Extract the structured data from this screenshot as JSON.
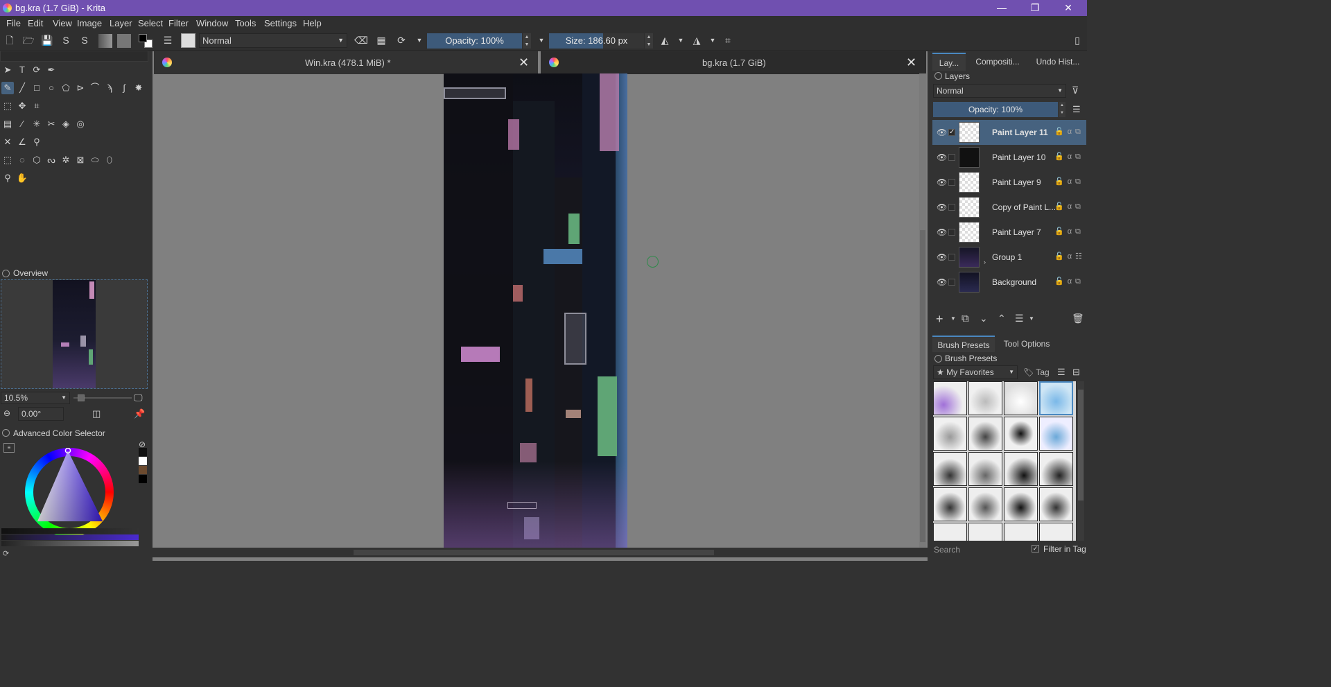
{
  "window": {
    "title": "bg.kra (1.7 GiB)  - Krita",
    "controls": {
      "minimize": "—",
      "restore": "❐",
      "close": "✕"
    }
  },
  "menu": [
    "File",
    "Edit",
    "View",
    "Image",
    "Layer",
    "Select",
    "Filter",
    "Window",
    "Tools",
    "Settings",
    "Help"
  ],
  "toolbar": {
    "blend_mode": "Normal",
    "opacity": "Opacity: 100%",
    "size": "Size: 186.60 px"
  },
  "overview": {
    "title": "Overview",
    "zoom": "10.5%",
    "rotation": "0.00°"
  },
  "color_selector": {
    "title": "Advanced Color Selector"
  },
  "documents": [
    {
      "label": "Win.kra (478.1 MiB) *"
    },
    {
      "label": "bg.kra (1.7 GiB)"
    }
  ],
  "right_tabs": [
    "Lay...",
    "Compositi...",
    "Undo Hist..."
  ],
  "layers": {
    "title": "Layers",
    "blend_mode": "Normal",
    "opacity": "Opacity:  100%",
    "items": [
      {
        "name": "Paint Layer 11",
        "selected": true
      },
      {
        "name": "Paint Layer 10",
        "selected": false
      },
      {
        "name": "Paint Layer 9",
        "selected": false
      },
      {
        "name": "Copy of Paint L...",
        "selected": false
      },
      {
        "name": "Paint Layer 7",
        "selected": false
      },
      {
        "name": "Group 1",
        "selected": false
      },
      {
        "name": "Background",
        "selected": false
      }
    ]
  },
  "bottom_tabs": [
    "Brush Presets",
    "Tool Options"
  ],
  "brush_presets": {
    "title": "Brush Presets",
    "tag_filter": "My Favorites",
    "tag_button": "Tag",
    "search_placeholder": "Search",
    "filter_in_tag": "Filter in Tag"
  }
}
